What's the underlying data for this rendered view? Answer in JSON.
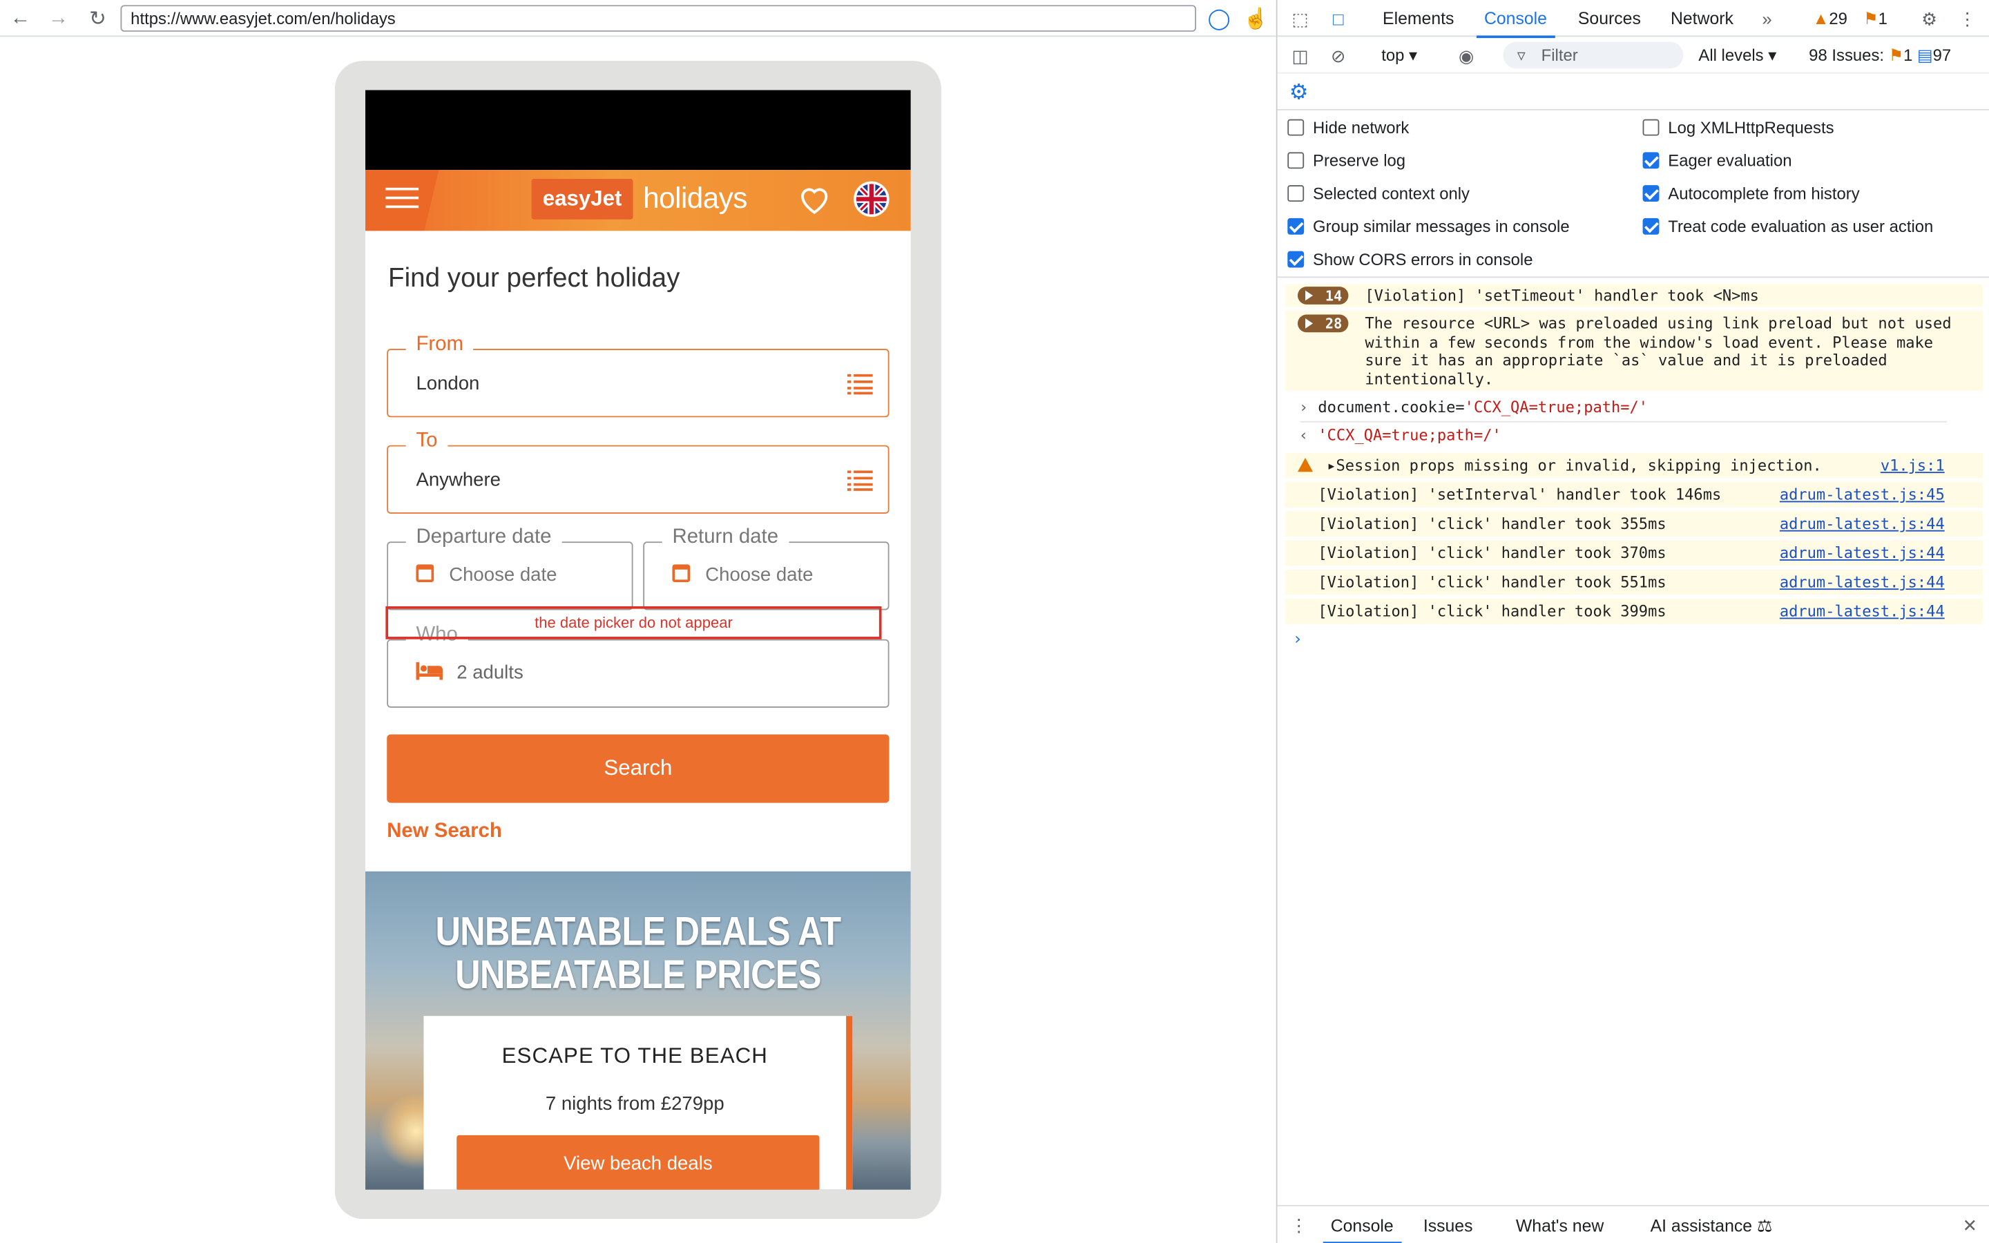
{
  "browser": {
    "url": "https://www.easyjet.com/en/holidays",
    "back_icon": "arrow-left",
    "forward_icon": "arrow-right",
    "reload_icon": "reload"
  },
  "page": {
    "brand": "easyJet",
    "brand_suffix": "holidays",
    "heading": "Find your perfect holiday",
    "from": {
      "label": "From",
      "value": "London"
    },
    "to": {
      "label": "To",
      "value": "Anywhere"
    },
    "departure": {
      "label": "Departure date",
      "placeholder": "Choose date"
    },
    "return": {
      "label": "Return date",
      "placeholder": "Choose date"
    },
    "annotation": "the date picker do not appear",
    "who": {
      "label": "Who",
      "value": "2 adults"
    },
    "search_label": "Search",
    "new_search_label": "New Search",
    "hero": {
      "title_line1": "UNBEATABLE DEALS AT",
      "title_line2": "UNBEATABLE PRICES",
      "card_title": "ESCAPE TO THE BEACH",
      "card_sub": "7 nights from £279pp",
      "card_button": "View beach deals"
    },
    "accent_color": "#ED6F2D"
  },
  "devtools": {
    "tabs": [
      "Elements",
      "Console",
      "Sources",
      "Network"
    ],
    "active_tab": "Console",
    "warnings_count": "29",
    "errors_count": "1",
    "context": "top",
    "filter_placeholder": "Filter",
    "levels": "All levels",
    "issues_label": "98 Issues:",
    "issues_errors": "1",
    "issues_info": "97",
    "options_left": [
      {
        "label": "Hide network",
        "checked": false
      },
      {
        "label": "Preserve log",
        "checked": false
      },
      {
        "label": "Selected context only",
        "checked": false
      },
      {
        "label": "Group similar messages in console",
        "checked": true
      },
      {
        "label": "Show CORS errors in console",
        "checked": true
      }
    ],
    "options_right": [
      {
        "label": "Log XMLHttpRequests",
        "checked": false
      },
      {
        "label": "Eager evaluation",
        "checked": true
      },
      {
        "label": "Autocomplete from history",
        "checked": true
      },
      {
        "label": "Treat code evaluation as user action",
        "checked": true
      }
    ],
    "messages": {
      "group1_count": "14",
      "group1_text": "[Violation] 'setTimeout' handler took <N>ms",
      "group2_count": "28",
      "group2_text": "The resource <URL> was preloaded using link preload but not used\nwithin a few seconds from the window's load event. Please make\nsure it has an appropriate `as` value and it is preloaded\nintentionally.",
      "input_code_prefix": "document.cookie=",
      "input_code_string": "'CCX_QA=true;path=/'",
      "output_value": "'CCX_QA=true;path=/'",
      "warning_text": "Session props missing or invalid, skipping injection.",
      "warning_link": "v1.js:1",
      "violations": [
        {
          "text": "[Violation] 'setInterval' handler took 146ms",
          "link": "adrum-latest.js:45"
        },
        {
          "text": "[Violation] 'click' handler took 355ms",
          "link": "adrum-latest.js:44"
        },
        {
          "text": "[Violation] 'click' handler took 370ms",
          "link": "adrum-latest.js:44"
        },
        {
          "text": "[Violation] 'click' handler took 551ms",
          "link": "adrum-latest.js:44"
        },
        {
          "text": "[Violation] 'click' handler took 399ms",
          "link": "adrum-latest.js:44"
        }
      ]
    },
    "drawer_tabs": [
      "Console",
      "Issues",
      "What's new",
      "AI assistance"
    ]
  }
}
